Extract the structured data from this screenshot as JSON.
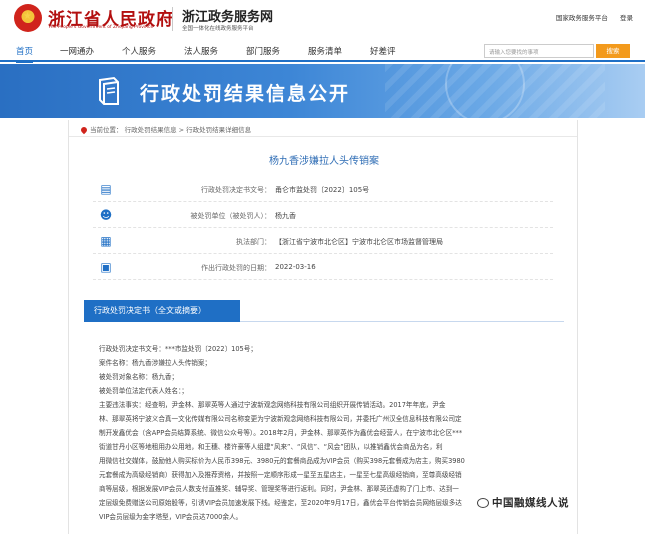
{
  "header": {
    "site_name": "浙江省人民政府",
    "site_name_en": "The People's Government of Zhejiang Province",
    "service_name": "浙江政务服务网",
    "service_sub": "全国一体化在线政务服务平台",
    "links": [
      "国家政务服务平台",
      "登录"
    ]
  },
  "nav": {
    "items": [
      "首页",
      "一网通办",
      "个人服务",
      "法人服务",
      "部门服务",
      "服务清单",
      "好差评"
    ],
    "active_index": 0,
    "search_placeholder": "请输入您要找的事项",
    "search_button": "搜索"
  },
  "banner": {
    "title": "行政处罚结果信息公开"
  },
  "breadcrumb": {
    "text": "当前位置： 行政处罚结果信息 > 行政处罚结果详细信息"
  },
  "document": {
    "title": "杨九香涉嫌拉人头传销案",
    "rows": [
      {
        "icon": "document-icon",
        "label": "行政处罚决定书文号：",
        "value": "甬仑市监处罚〔2022〕105号"
      },
      {
        "icon": "person-icon",
        "label": "被处罚单位（被处罚人）：",
        "value": "杨九香"
      },
      {
        "icon": "building-icon",
        "label": "执法部门：",
        "value": "【浙江省宁波市北仑区】宁波市北仑区市场监督管理局"
      },
      {
        "icon": "calendar-icon",
        "label": "作出行政处罚的日期：",
        "value": "2022-03-16"
      }
    ],
    "section_tab": "行政处罚决定书（全文或摘要）",
    "body_lines": [
      "行政处罚决定书文号：***市监处罚〔2022〕105号；",
      "案件名称：杨九香涉嫌拉人头传销案；",
      "被处罚对象名称：杨九香；",
      "被处罚单位法定代表人姓名：；",
      "主要违法事实：经查明，尹金林、那翠英等人通过宁波新观念网络科技有限公司组织开展传销活动。2017年年底，尹金",
      "林、那翠英将宁波义合真一文化传媒有限公司名称变更为宁波新观念网络科技有限公司，并委托广州汉全信息科技有限公司定",
      "制开发鑫优会（含APP会员结算系统、微信公众号等）。2018年2月，尹金林、那翠英作为鑫优会经营人，在宁波市北仑区***",
      "街道甘丹小区等地租用办公用地，和王穗、楼许豪等人组建“风来”、“风信”、“风会”团队，以推销鑫优会商品为名，利",
      "用微信社交媒体，鼓励他人购买标价为人民币398元、3980元的套餐商品成为VIP会员（购买398元套餐成为店主，购买3980",
      "元套餐成为高级经销商）获得加入及推荐资格，并按照一定顺序形成一星至五星店主，一星至七星高级经销商，至尊高级经销",
      "商等层级，根据发展VIP会员人数支付直推奖、辅导奖、管理奖等进行返利。同时，尹金林、那翠英还虚构了门上市、达到一",
      "定层级免费赠送公司原始股等，引诱VIP会员加速发展下线。经鉴定，至2020年9月17日，鑫优会平台传销会员网络层级多达",
      "VIP会员层级为金字塔型，VIP会员达7000余人。"
    ]
  },
  "watermark": {
    "text": "中国融媒线人说"
  },
  "colors": {
    "brand_red": "#b30f0f",
    "accent_blue": "#1f6fc5",
    "search_orange": "#f39a1c"
  }
}
